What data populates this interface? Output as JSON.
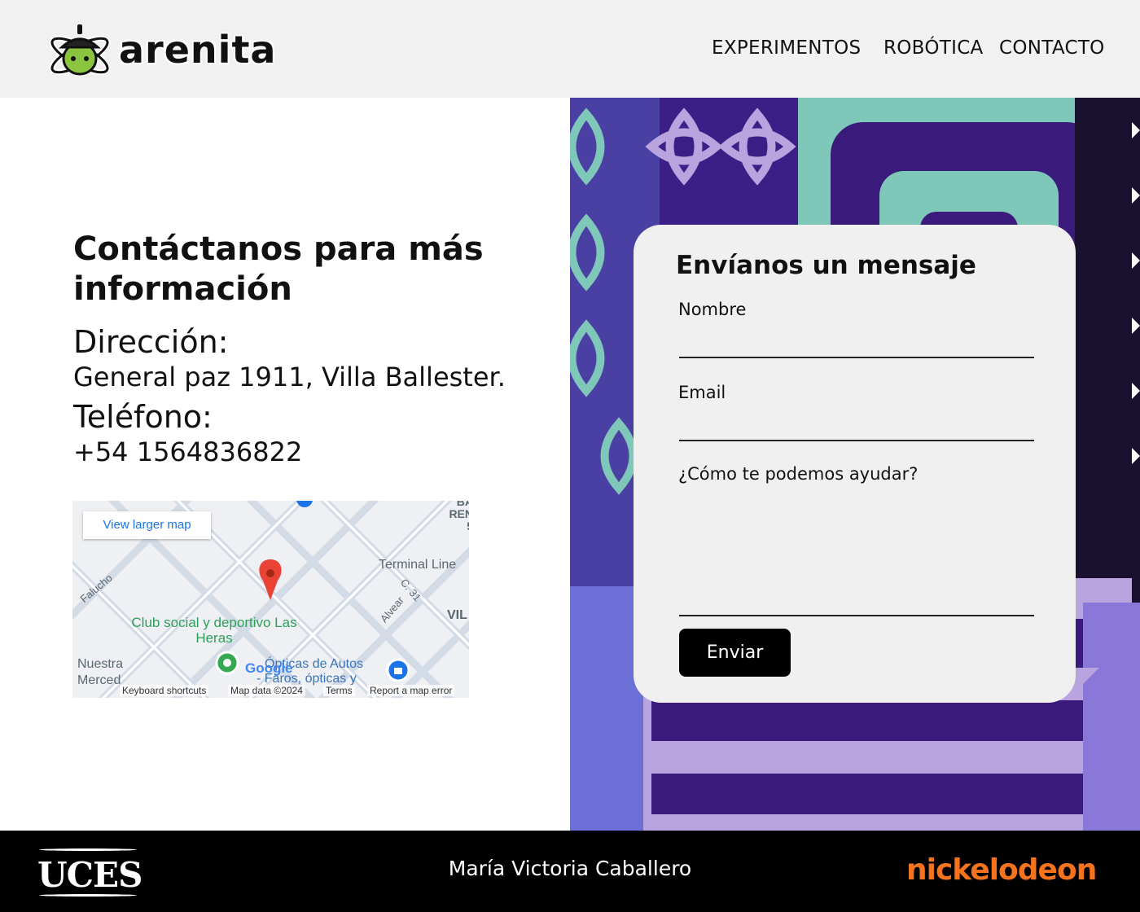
{
  "header": {
    "logo_text": "arenita",
    "nav": [
      "EXPERIMENTOS",
      "ROBÓTICA",
      "CONTACTO"
    ]
  },
  "contact": {
    "title": "Contáctanos para más información",
    "address_label": "Dirección:",
    "address": "General paz 1911, Villa Ballester.",
    "phone_label": "Teléfono:",
    "phone": "+54 1564836822"
  },
  "map": {
    "view_larger": "View larger map",
    "labels": {
      "falucho": "Falucho",
      "terminal": "Terminal Line",
      "calle": "C. 31",
      "alvear": "Alvear",
      "vil": "VIL",
      "club": "Club social y deportivo Las Heras",
      "nuestra": "Nuestra",
      "merced": "Merced",
      "opticas": "Ópticas de Autos",
      "faros": "- Faros, ópticas y",
      "corner": "BA REN 5",
      "google": "Google"
    },
    "bottom_bar": [
      "Keyboard shortcuts",
      "Map data ©2024",
      "Terms",
      "Report a map error"
    ]
  },
  "form": {
    "title": "Envíanos un mensaje",
    "name_label": "Nombre",
    "email_label": "Email",
    "message_label": "¿Cómo te podemos ayudar?",
    "submit_label": "Enviar"
  },
  "footer": {
    "left_logo": "UCES",
    "author": "María Victoria Caballero",
    "right_logo": "nickelodeon"
  },
  "colors": {
    "header_bg": "#f1f1f1",
    "card_bg": "#f0f0f0",
    "button_bg": "#000000",
    "footer_bg": "#000000",
    "nick_orange": "#f5731d",
    "pattern_purple": "#3a1a7a",
    "pattern_teal": "#7fc7b8",
    "pattern_lavender": "#b9a4e0",
    "pattern_blue": "#6b6fd6"
  }
}
